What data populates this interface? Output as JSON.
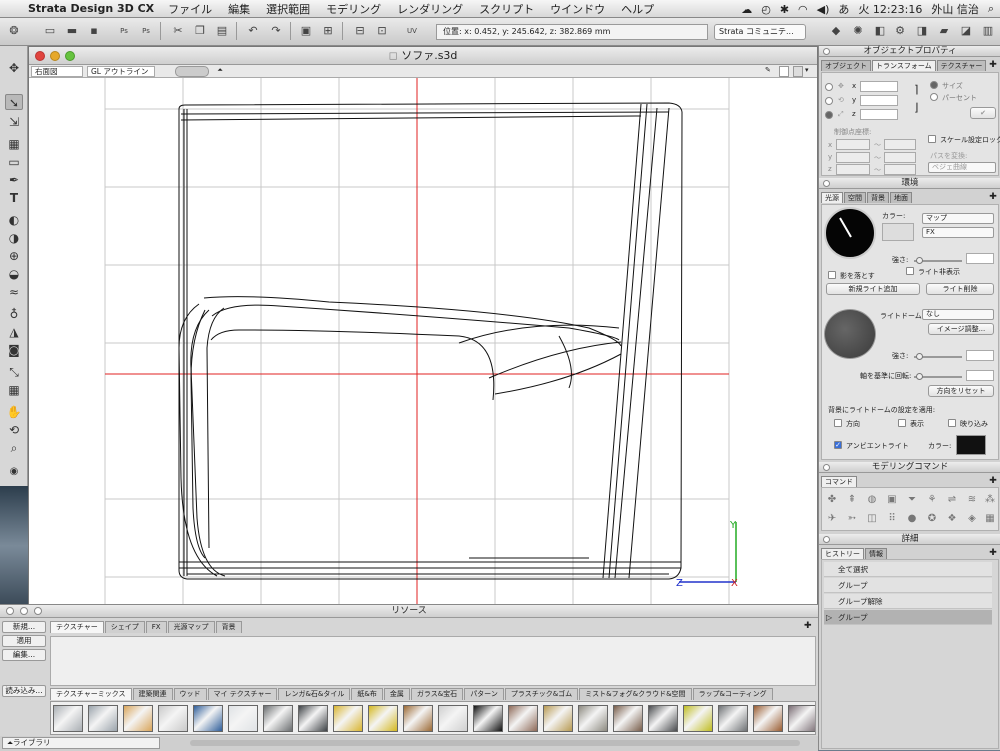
{
  "menubar": {
    "app_name": "Strata Design 3D CX",
    "items": [
      "ファイル",
      "編集",
      "選択範囲",
      "モデリング",
      "レンダリング",
      "スクリプト",
      "ウインドウ",
      "ヘルプ"
    ],
    "clock": "火 12:23:16",
    "user": "外山 信治"
  },
  "toolbar": {
    "coords": "位置: x: 0.452, y: 245.642, z: 382.869 mm",
    "community": "Strata コミュニテ..."
  },
  "document": {
    "title": "ソファ.s3d",
    "view_select": "右面図",
    "render_select": "GL アウトライン"
  },
  "resources": {
    "title": "リソース",
    "buttons": [
      "新規...",
      "適用",
      "編集..."
    ],
    "load_button": "読み込み...",
    "tabs": [
      "テクスチャー",
      "シェイプ",
      "FX",
      "光源マップ",
      "背景"
    ],
    "categories": [
      "テクスチャーミックス",
      "建築関連",
      "ウッド",
      "マイ テクスチャー",
      "レンガ&石&タイル",
      "紙&布",
      "金属",
      "ガラス&宝石",
      "パターン",
      "プラスチック&ゴム",
      "ミスト&フォグ&クラウド&空間",
      "ラップ&コーティング"
    ],
    "library_label": "ライブラリ",
    "swatch_colors": [
      "#a9aeb3",
      "#9aa3ab",
      "#d9a55a",
      "#c9c9c9",
      "#2f5e9a",
      "#dfe2e5",
      "#6b6e70",
      "#3f4347",
      "#d9b530",
      "#d4b820",
      "#9c6a35",
      "#cfcfcf",
      "#111111",
      "#8e6a58",
      "#b89a52",
      "#8d8a80",
      "#785d4a",
      "#4a4c4f",
      "#c0bd21",
      "#6f7275",
      "#9a5d32",
      "#7a6d74"
    ]
  },
  "object_props": {
    "title": "オブジェクトプロパティ",
    "tabs": [
      "オブジェクト",
      "トランスフォーム",
      "テクスチャー"
    ],
    "axes": [
      "x",
      "y",
      "z"
    ],
    "size_label": "サイズ",
    "percent_label": "パーセント",
    "control_label": "制御点座標:",
    "scale_lock": "スケール設定ロック",
    "path_convert": "パスを変換:",
    "bezier": "ベジェ曲線"
  },
  "environment": {
    "title": "環境",
    "tabs": [
      "光源",
      "空間",
      "背景",
      "地面"
    ],
    "color_label": "カラー:",
    "map_select": "マップ",
    "fx_select": "FX",
    "strength_label": "強さ:",
    "cast_shadow": "影を落とす",
    "hide_light": "ライト非表示",
    "add_light": "新規ライト追加",
    "delete_light": "ライト削除",
    "lightdome_label": "ライトドーム:",
    "lightdome_value": "なし",
    "image_adjust": "イメージ調整...",
    "rotate_label": "軸を基準に回転:",
    "reset_dir": "方向をリセット",
    "apply_label": "背景にライトドームの設定を適用:",
    "apply_opts": [
      "方向",
      "表示",
      "映り込み"
    ],
    "ambient": "アンビエントライト",
    "ambient_color": "#111111"
  },
  "modeling": {
    "title": "モデリングコマンド",
    "tab": "コマンド"
  },
  "details": {
    "title": "詳細",
    "tabs": [
      "ヒストリー",
      "情報"
    ],
    "history": [
      "全て選択",
      "グループ",
      "グループ解除",
      "グループ"
    ]
  },
  "axis_labels": {
    "y": "Y",
    "z": "Z",
    "x": "X"
  }
}
